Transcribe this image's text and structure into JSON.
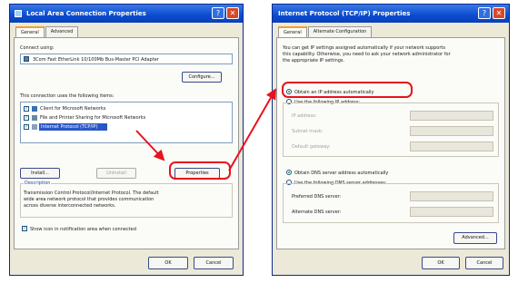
{
  "left": {
    "title": "Local Area Connection Properties",
    "tabs": [
      "General",
      "Advanced"
    ],
    "connect_label": "Connect using:",
    "adapter": "3Com Fast EtherLink 10/100Mb Bus-Master PCI Adapter",
    "configure": "Configure...",
    "items_label": "This connection uses the following items:",
    "items": [
      {
        "label": "Client for Microsoft Networks",
        "checked": true
      },
      {
        "label": "File and Printer Sharing for Microsoft Networks",
        "checked": true
      },
      {
        "label": "Internet Protocol (TCP/IP)",
        "checked": true
      }
    ],
    "install": "Install...",
    "uninstall": "Uninstall",
    "properties": "Properties",
    "description_label": "Description",
    "description": [
      "Transmission Control Protocol/Internet Protocol. The default",
      "wide area network protocol that provides communication",
      "across diverse interconnected networks."
    ],
    "show_icon": "Show icon in notification area when connected",
    "ok": "OK",
    "cancel": "Cancel"
  },
  "right": {
    "title": "Internet Protocol (TCP/IP) Properties",
    "tabs": [
      "General",
      "Alternate Configuration"
    ],
    "intro": [
      "You can get IP settings assigned automatically if your network supports",
      "this capability. Otherwise, you need to ask your network administrator for",
      "the appropriate IP settings."
    ],
    "obtain_ip": "Obtain an IP address automatically",
    "use_ip": "Use the following IP address:",
    "ip_address": "IP address:",
    "subnet": "Subnet mask:",
    "gateway": "Default gateway:",
    "obtain_dns": "Obtain DNS server address automatically",
    "use_dns": "Use the following DNS server addresses:",
    "preferred_dns": "Preferred DNS server:",
    "alternate_dns": "Alternate DNS server:",
    "advanced": "Advanced...",
    "ok": "OK",
    "cancel": "Cancel"
  },
  "colors": {
    "highlight": "#e8121c",
    "titlebar": "#0a4ccf",
    "selection": "#2a56c6"
  }
}
